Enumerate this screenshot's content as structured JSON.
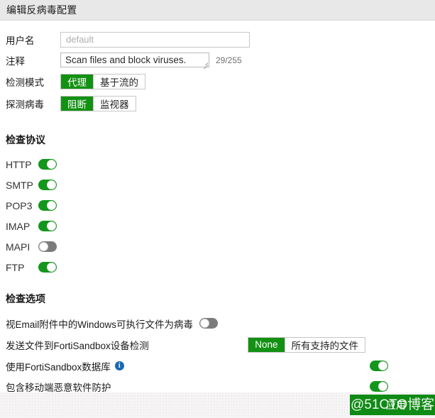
{
  "window": {
    "title": "编辑反病毒配置"
  },
  "form": {
    "name_label": "用户名",
    "name_value": "",
    "name_placeholder": "default",
    "comment_label": "注释",
    "comment_value": "Scan files and block viruses.",
    "comment_counter": "29/255",
    "detect_mode_label": "检测模式",
    "detect_mode_options": [
      "代理",
      "基于流的"
    ],
    "detect_mode_selected": "代理",
    "virus_action_label": "探测病毒",
    "virus_action_options": [
      "阻断",
      "监视器"
    ],
    "virus_action_selected": "阻断"
  },
  "protocols": {
    "heading": "检查协议",
    "items": [
      {
        "name": "HTTP",
        "enabled": true
      },
      {
        "name": "SMTP",
        "enabled": true
      },
      {
        "name": "POP3",
        "enabled": true
      },
      {
        "name": "IMAP",
        "enabled": true
      },
      {
        "name": "MAPI",
        "enabled": false
      },
      {
        "name": "FTP",
        "enabled": true
      }
    ]
  },
  "options": {
    "heading": "检查选项",
    "treat_windows_exe": {
      "label": "视Email附件中的Windows可执行文件为病毒",
      "enabled": false
    },
    "send_to_sandbox": {
      "label": "发送文件到FortiSandbox设备检测",
      "choices": [
        "None",
        "所有支持的文件"
      ],
      "selected": "None"
    },
    "use_sandbox_db": {
      "label": "使用FortiSandbox数据库",
      "info_icon": "info-icon",
      "info_glyph": "i",
      "enabled": true
    },
    "mobile_malware": {
      "label": "包含移动端恶意软件防护",
      "enabled": true
    }
  },
  "footer": {
    "apply_label": "应用"
  },
  "watermark": {
    "text": "@51CTO博客"
  },
  "colors": {
    "accent_green": "#139113",
    "toggle_on": "#12961b",
    "toggle_off": "#7b7b7b",
    "info_blue": "#1868b5",
    "titlebar_bg": "#e8e8e8"
  }
}
